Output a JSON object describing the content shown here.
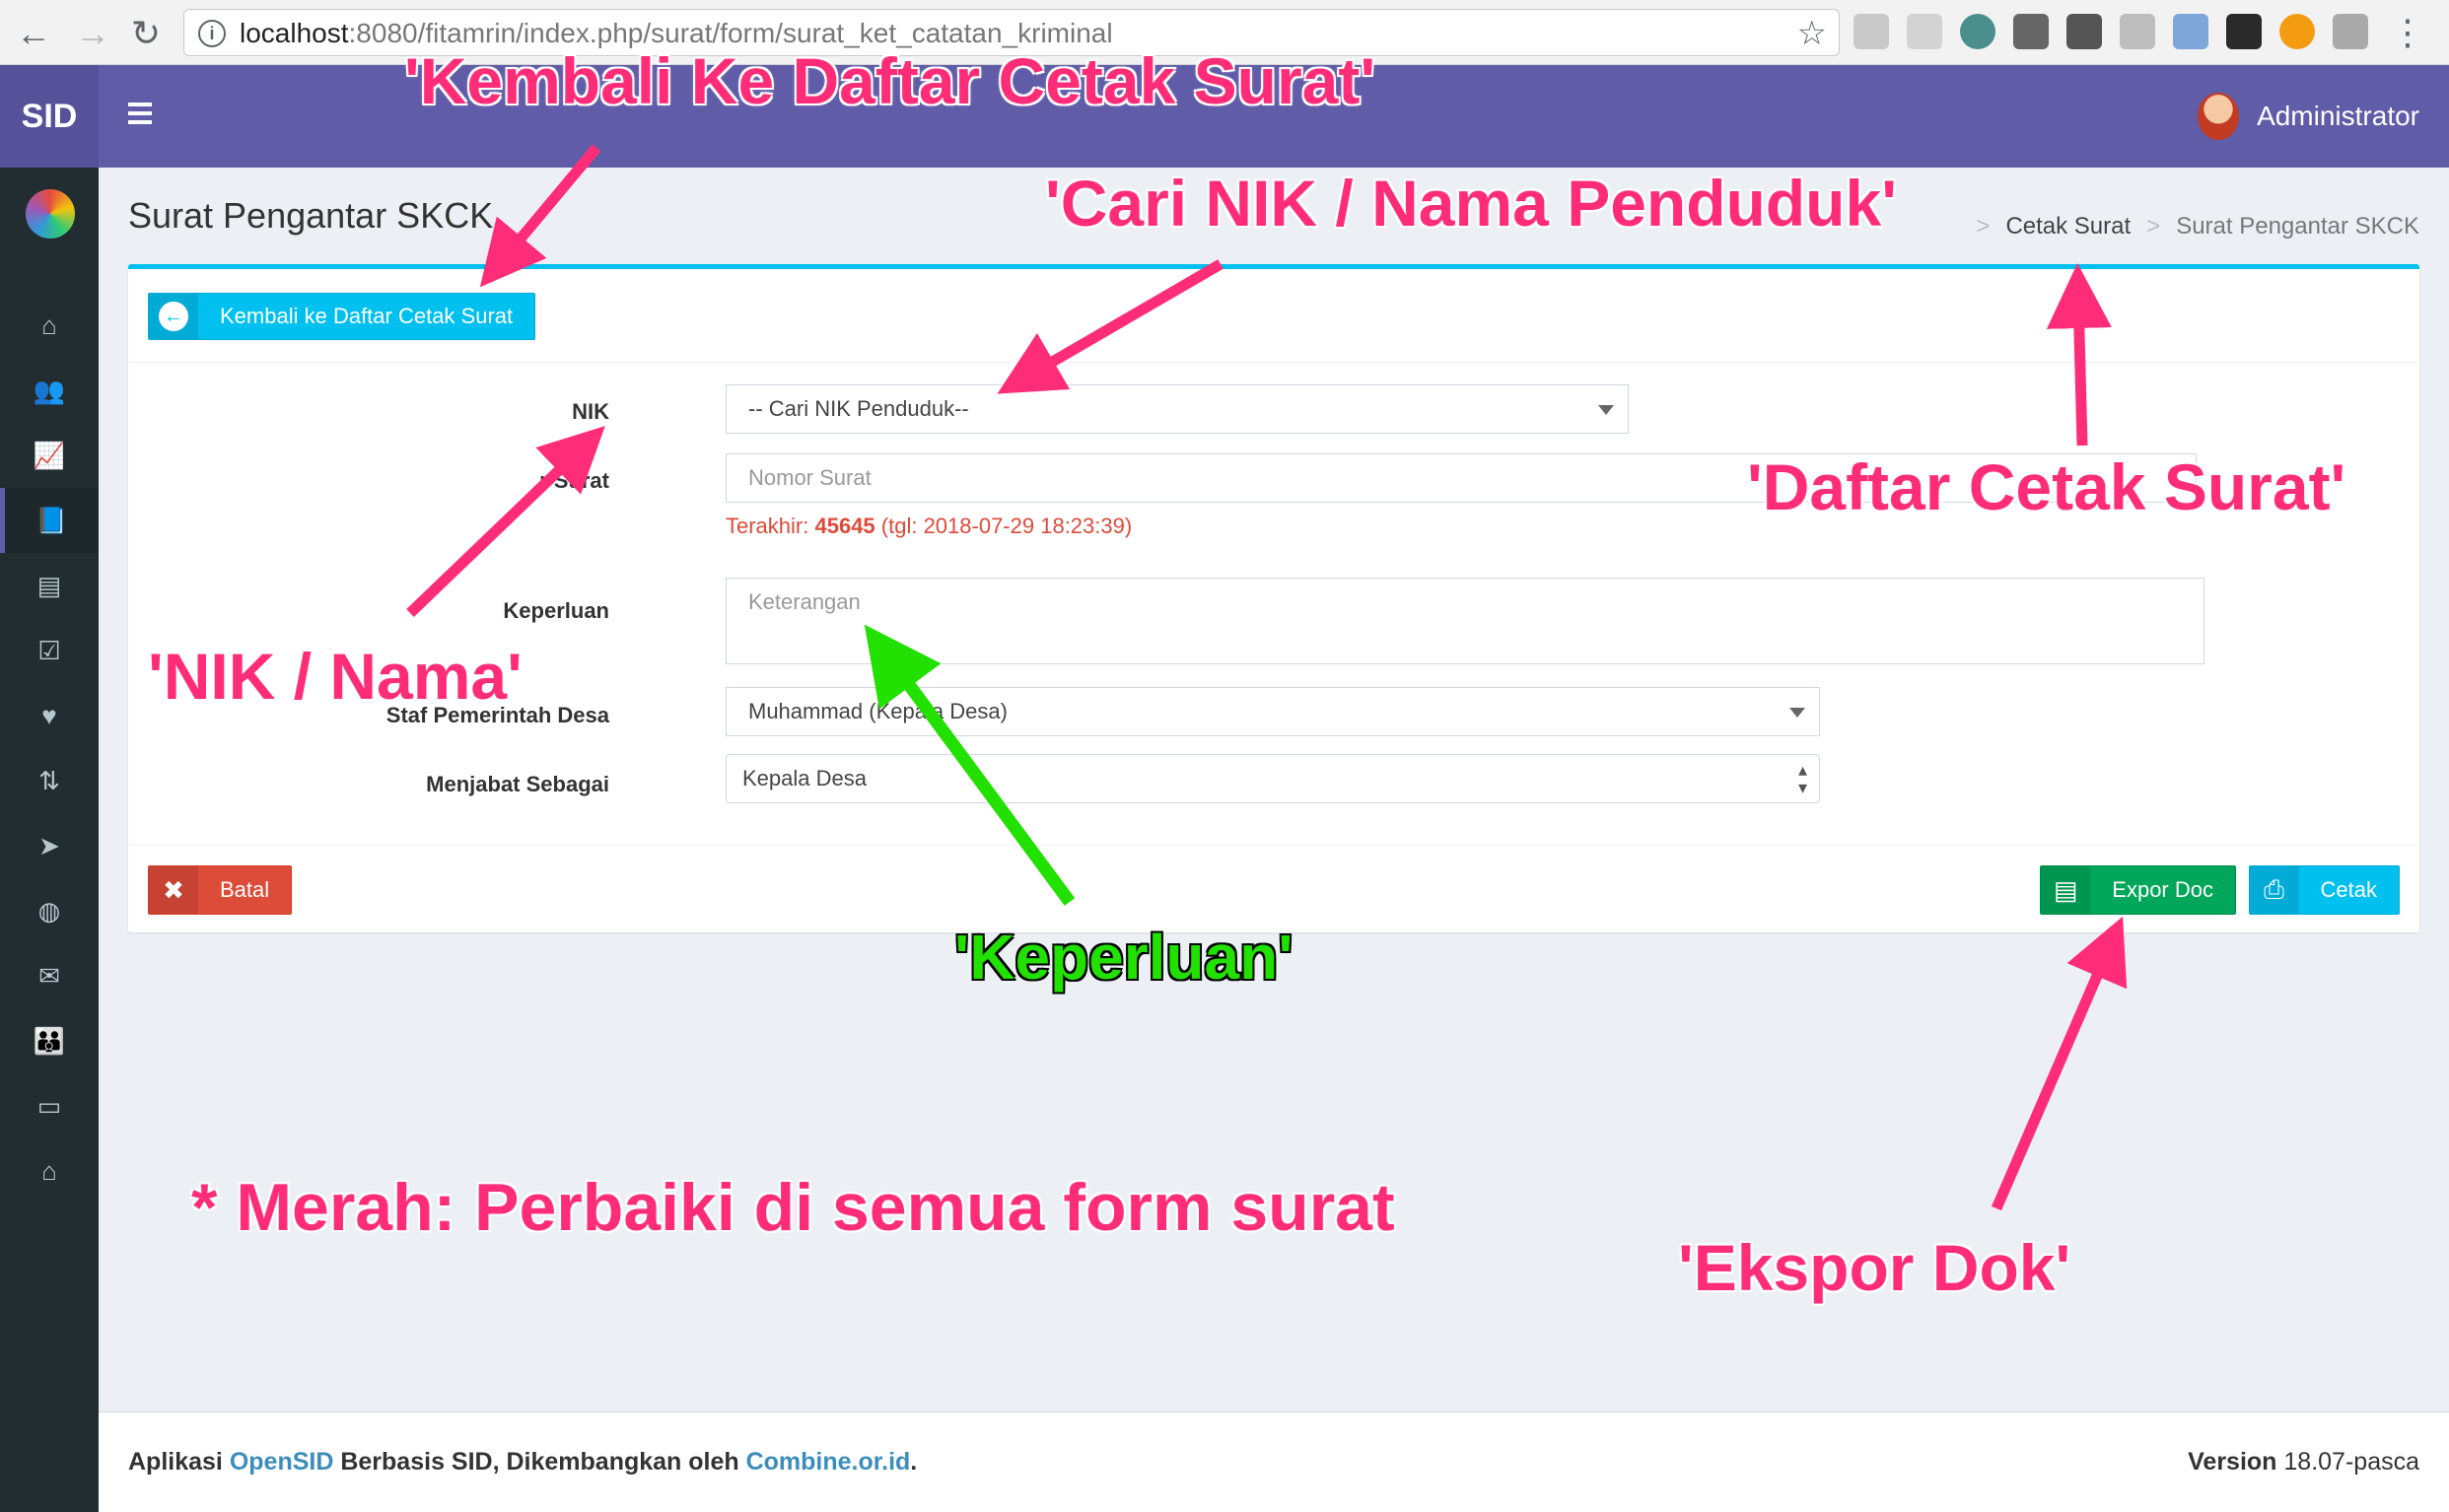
{
  "browser": {
    "url_host": "localhost",
    "url_rest": ":8080/fitamrin/index.php/surat/form/surat_ket_catatan_kriminal"
  },
  "app": {
    "brand": "SID",
    "user_name": "Administrator"
  },
  "page": {
    "title": "Surat Pengantar SKCK",
    "breadcrumb": [
      "Cetak Surat",
      "Surat Pengantar SKCK"
    ]
  },
  "form": {
    "back_button": "Kembali ke Daftar Cetak Surat",
    "nik_label": "NIK",
    "nik_select": "-- Cari NIK Penduduk--",
    "nomor_label": "r Surat",
    "nomor_placeholder": "Nomor Surat",
    "last_prefix": "Terakhir: ",
    "last_number": "45645",
    "last_date": " (tgl: 2018-07-29 18:23:39)",
    "keperluan_label": "Keperluan",
    "keperluan_placeholder": "Keterangan",
    "staf_label": "Staf Pemerintah Desa",
    "staf_value": "Muhammad (Kepala Desa)",
    "jabatan_label": "Menjabat Sebagai",
    "jabatan_value": "Kepala Desa",
    "cancel_button": "Batal",
    "export_button": "Expor Doc",
    "print_button": "Cetak"
  },
  "footer": {
    "text_a": "Aplikasi ",
    "link_a": "OpenSID",
    "text_b": " Berbasis SID, Dikembangkan oleh ",
    "link_b": "Combine.or.id",
    "text_c": ".",
    "version_label": "Version",
    "version_value": " 18.07-pasca"
  },
  "annotations": {
    "kembali": "'Kembali Ke Daftar Cetak Surat'",
    "cari_nik": "'Cari NIK / Nama Penduduk'",
    "daftar_cetak": "'Daftar Cetak Surat'",
    "nik_nama": "'NIK / Nama'",
    "keperluan": "'Keperluan'",
    "merah": "* Merah: Perbaiki di semua form surat",
    "ekspor": "'Ekspor Dok'"
  },
  "colors": {
    "header": "#605ca8",
    "sidebar": "#222d32",
    "box_accent": "#00c0ef",
    "annotation_pink": "#ff2d78",
    "annotation_green": "#22e000"
  }
}
